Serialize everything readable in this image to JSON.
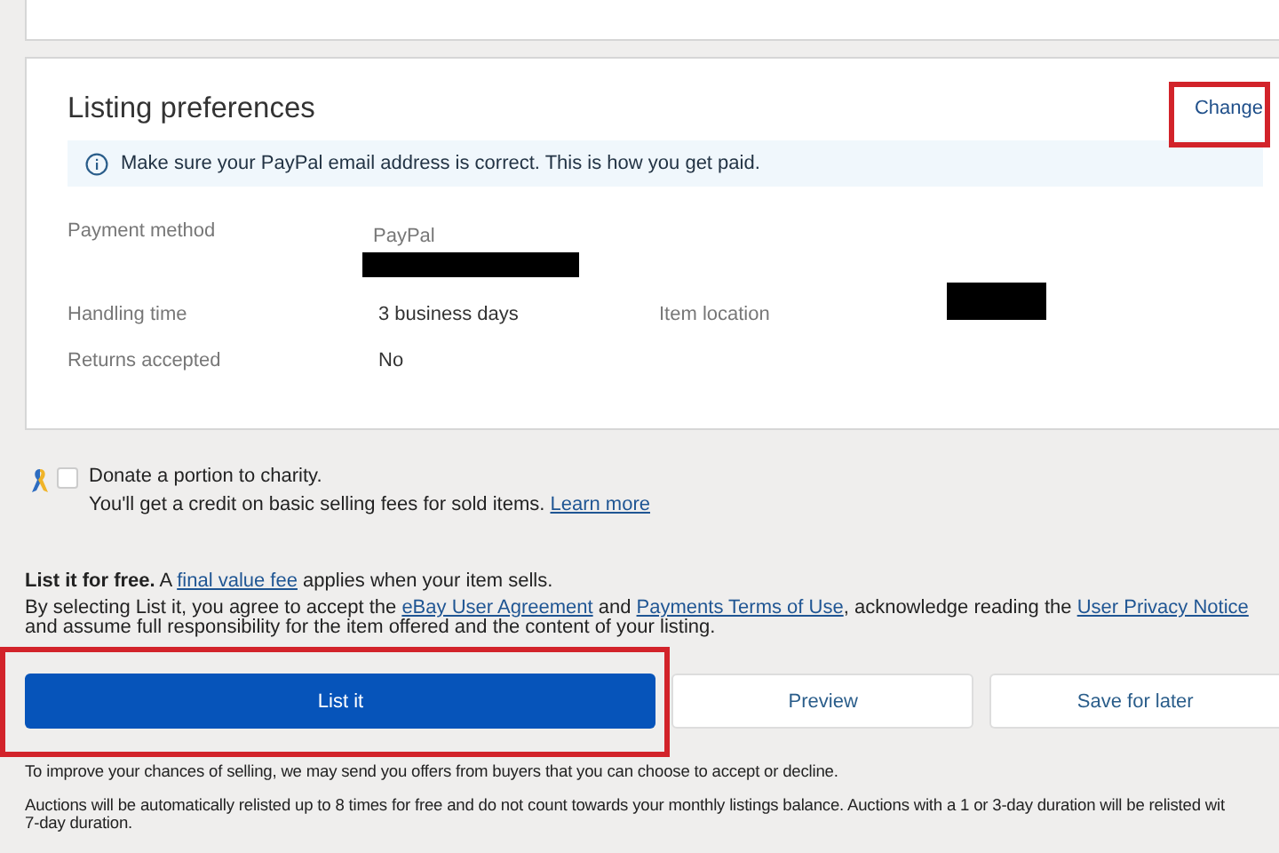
{
  "listing_preferences": {
    "title": "Listing preferences",
    "change_link": "Change",
    "notice": "Make sure your PayPal email address is correct. This is how you get paid.",
    "rows": [
      {
        "label": "Payment method",
        "value": "PayPal",
        "redacted": true
      },
      {
        "label": "Handling time",
        "value": "3 business days",
        "extra_label": "Item location",
        "extra_redacted": true
      },
      {
        "label": "Returns accepted",
        "value": "No"
      }
    ]
  },
  "charity": {
    "checked": false,
    "label": "Donate a portion to charity.",
    "note": "You'll get a credit on basic selling fees for sold items.",
    "link": "Learn more"
  },
  "terms": [
    [
      {
        "kind": "bold",
        "text": "List it for free."
      },
      {
        "kind": "text",
        "text": " A "
      },
      {
        "kind": "link",
        "text": "final value fee"
      },
      {
        "kind": "text",
        "text": " applies when your item sells."
      }
    ],
    [
      {
        "kind": "text",
        "text": "By selecting List it, you agree to accept the "
      },
      {
        "kind": "link",
        "text": "eBay User Agreement"
      },
      {
        "kind": "text",
        "text": " and "
      },
      {
        "kind": "link",
        "text": "Payments Terms of Use"
      },
      {
        "kind": "text",
        "text": ", acknowledge reading the "
      },
      {
        "kind": "link",
        "text": "User Privacy Notice"
      },
      {
        "kind": "text",
        "text": " and assume full responsibility for the item offered and the content of your listing."
      }
    ]
  ],
  "buttons": [
    {
      "label": "List it",
      "kind": "primary"
    },
    {
      "label": "Preview",
      "kind": "secondary"
    },
    {
      "label": "Save for later",
      "kind": "secondary"
    }
  ],
  "notes": [
    "To improve your chances of selling, we may send you offers from buyers that you can choose to accept or decline.",
    "Auctions will be automatically relisted up to 8 times for free and do not count towards your monthly listings balance. Auctions with a 1 or 3-day duration will be relisted wit\n7-day duration."
  ]
}
